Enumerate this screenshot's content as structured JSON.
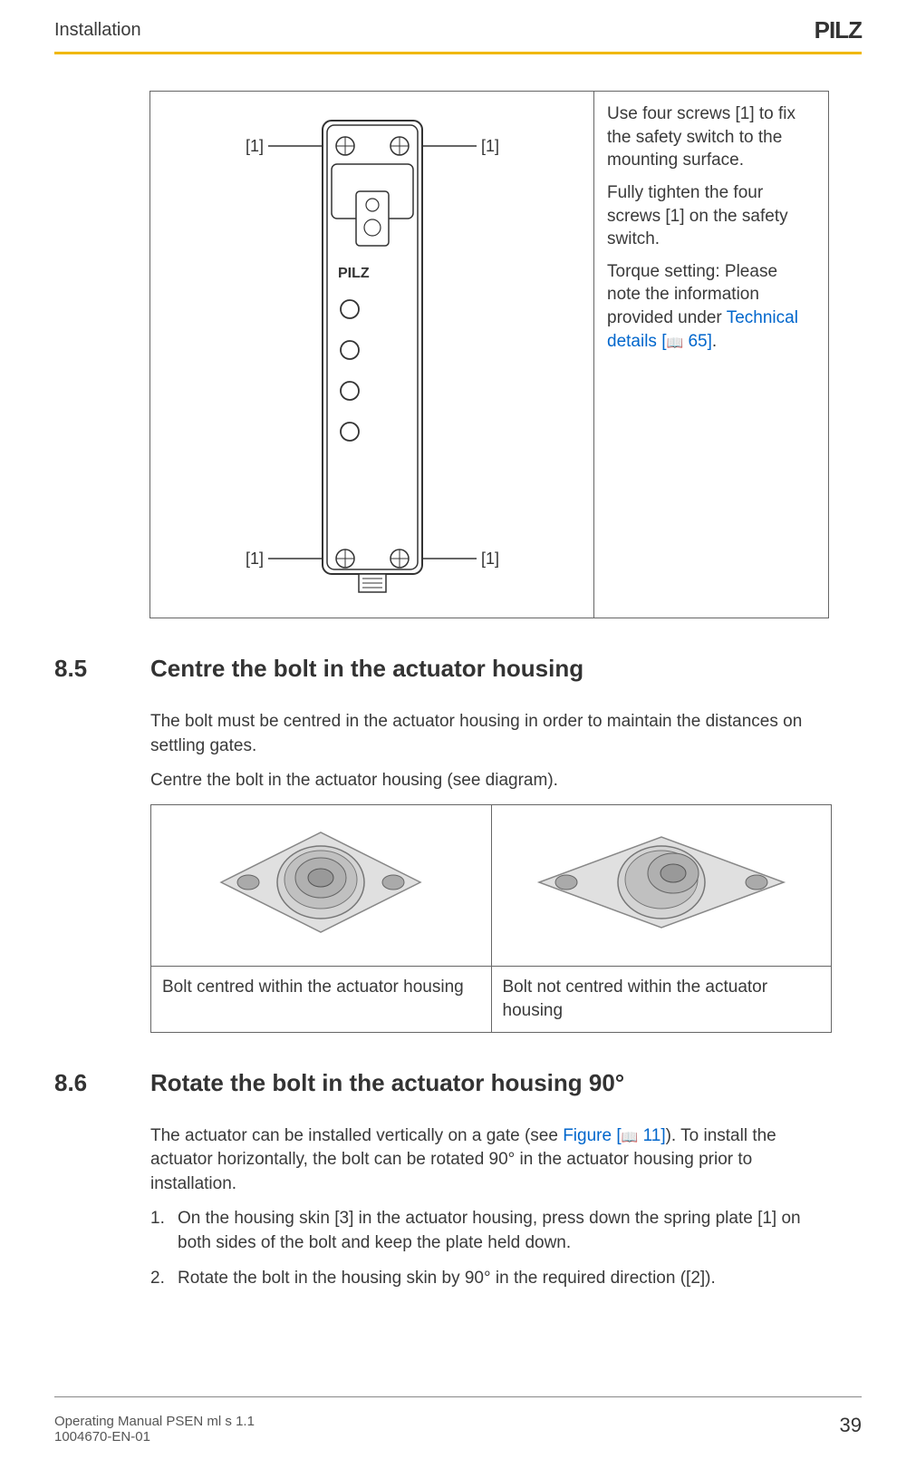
{
  "header": {
    "left": "Installation",
    "logo": "PILZ"
  },
  "fig1": {
    "label_tl": "[1]",
    "label_tr": "[1]",
    "label_bl": "[1]",
    "label_br": "[1]",
    "brand": "PILZ"
  },
  "instructions": {
    "p1": "Use four screws [1] to fix the safety switch to the mounting surface.",
    "p2": "Fully tighten the four screws [1] on the safety switch.",
    "p3a": "Torque setting: Please note the information provided under ",
    "link1": "Technical details [",
    "link1_page": " 65]",
    "p3b": "."
  },
  "s85": {
    "num": "8.5",
    "title": "Centre the bolt in the actuator housing",
    "p1": "The bolt must be centred in the actuator housing in order to maintain the distances on settling gates.",
    "p2": "Centre the bolt in the actuator housing (see diagram).",
    "cap_left": "Bolt centred within the actuator housing",
    "cap_right": "Bolt not centred within the actuator housing"
  },
  "s86": {
    "num": "8.6",
    "title": "Rotate the bolt in the actuator housing 90°",
    "p1a": "The actuator can be installed vertically on a gate (see ",
    "link2": "Figure [",
    "link2_page": " 11]",
    "p1b": "). To install the actuator horizontally, the bolt can be rotated 90° in the actuator housing prior to installation.",
    "li1_num": "1.",
    "li1": "On the housing skin [3] in the actuator housing, press down the spring plate [1] on both sides of the bolt and keep the plate held down.",
    "li2_num": "2.",
    "li2": "Rotate the bolt in the housing skin by 90° in the required direction ([2])."
  },
  "footer": {
    "line1": "Operating Manual PSEN ml s 1.1",
    "line2": "1004670-EN-01",
    "page": "39"
  }
}
